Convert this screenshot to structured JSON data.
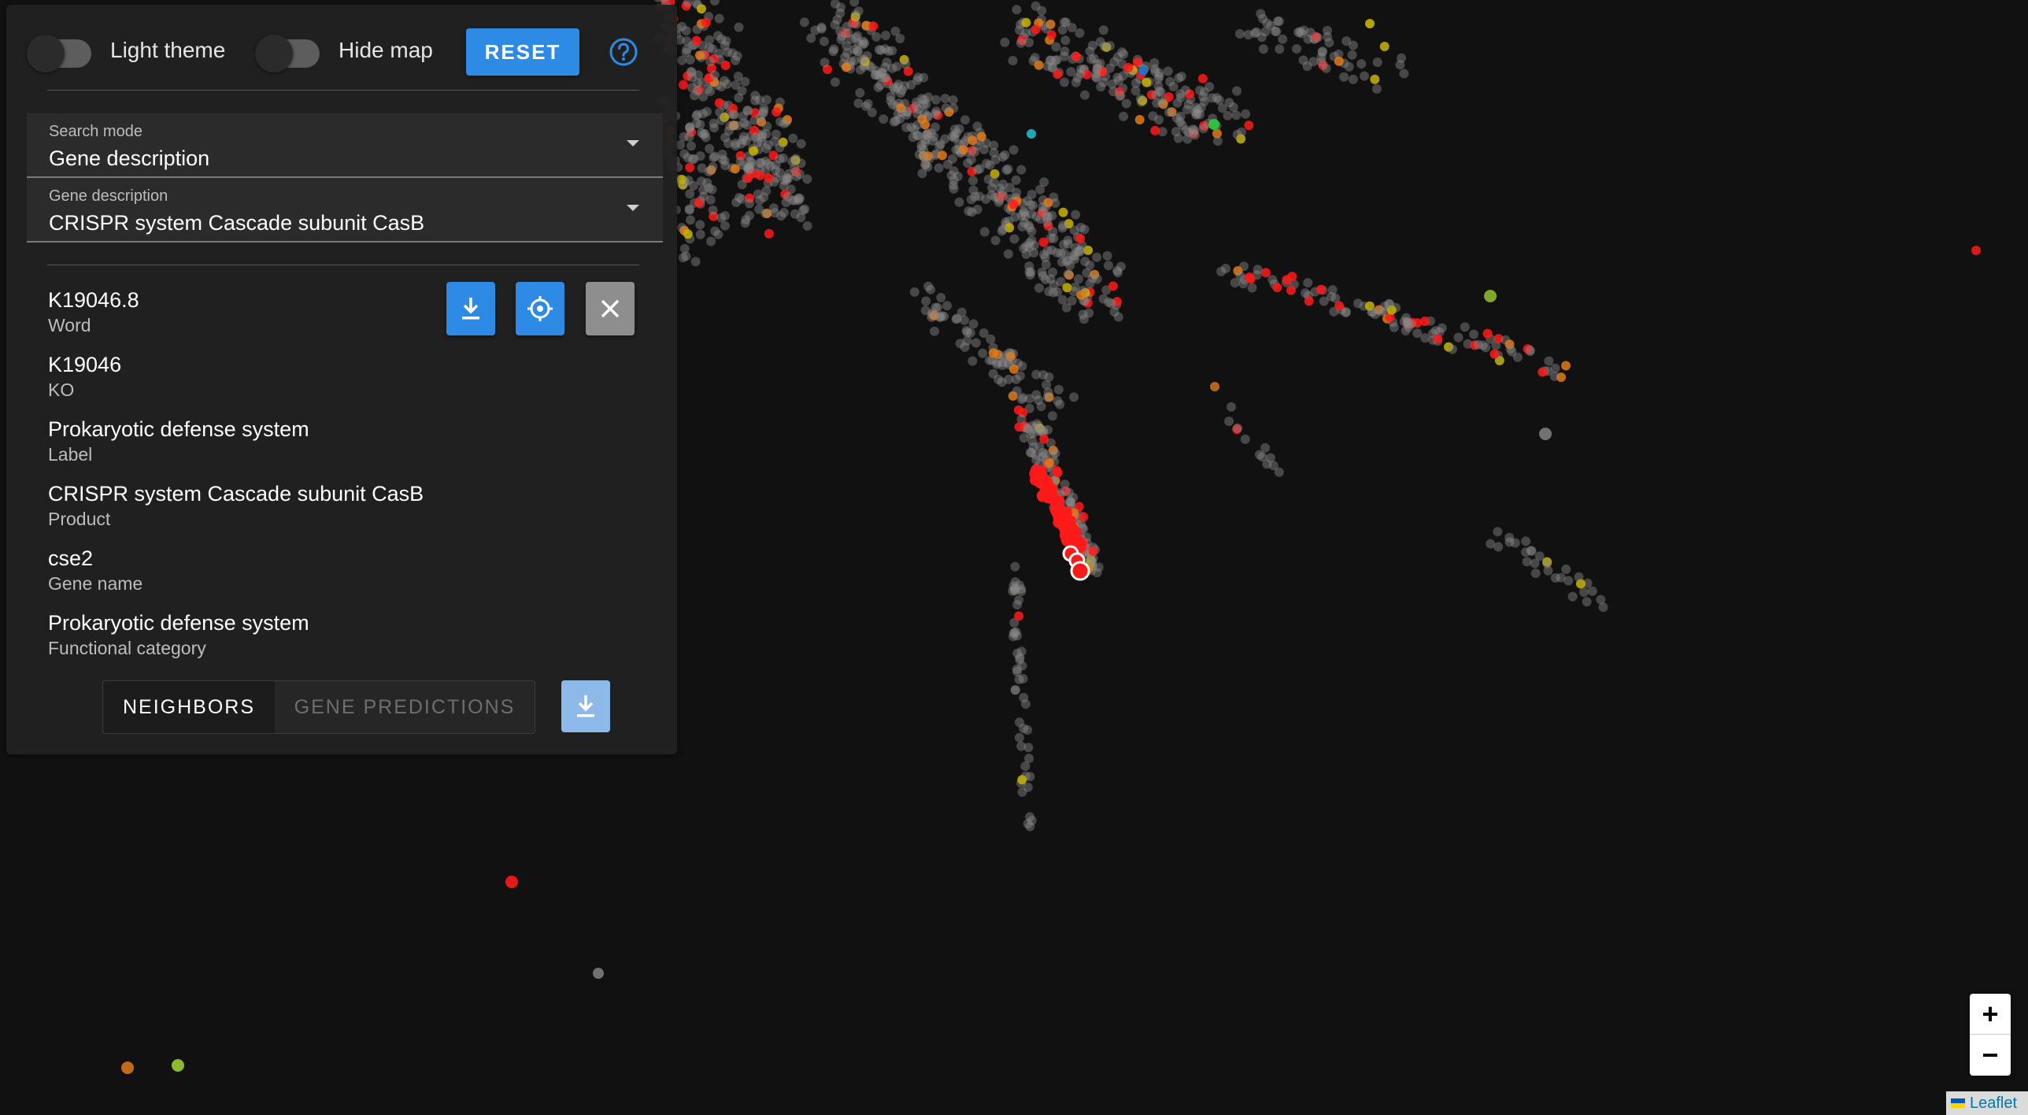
{
  "map": {
    "background": "#111111",
    "point_colors": {
      "gray": "#8a8a8a",
      "red": "#ff1a1a",
      "orange": "#e07a1a",
      "yellow": "#c8b400",
      "lime": "#9acd32",
      "green": "#2ecc40",
      "blue": "#1f6fd1",
      "cyan": "#20b8c8"
    }
  },
  "toolbar": {
    "light_theme_label": "Light theme",
    "hide_map_label": "Hide map",
    "reset_label": "RESET",
    "help_icon": "help-circle-icon"
  },
  "search_mode": {
    "label": "Search mode",
    "value": "Gene description"
  },
  "gene_description": {
    "label": "Gene description",
    "value": "CRISPR system Cascade subunit CasB"
  },
  "details": [
    {
      "value": "K19046.8",
      "key": "Word"
    },
    {
      "value": "K19046",
      "key": "KO"
    },
    {
      "value": "Prokaryotic defense system",
      "key": "Label"
    },
    {
      "value": "CRISPR system Cascade subunit CasB",
      "key": "Product"
    },
    {
      "value": "cse2",
      "key": "Gene name"
    },
    {
      "value": "Prokaryotic defense system",
      "key": "Functional category"
    }
  ],
  "actions": {
    "download_icon": "download-icon",
    "locate_icon": "crosshair-icon",
    "close_icon": "close-icon",
    "primary_color": "#2d8be6",
    "close_color": "#8e8e8e"
  },
  "tabs": {
    "neighbors": "NEIGHBORS",
    "predictions": "GENE PREDICTIONS"
  },
  "zoom": {
    "in_label": "+",
    "out_label": "−"
  },
  "attribution": {
    "text": "Leaflet"
  }
}
